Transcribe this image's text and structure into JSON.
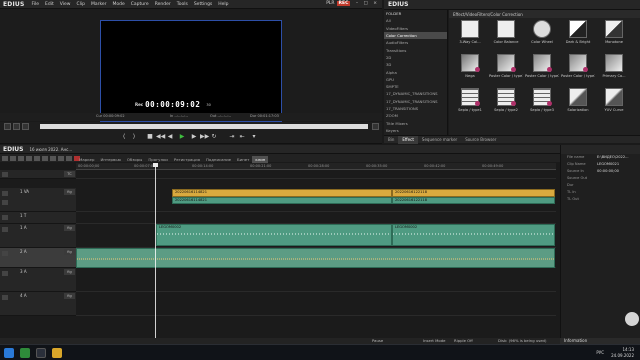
{
  "menubar": {
    "logo": "EDIUS",
    "items": [
      "File",
      "Edit",
      "View",
      "Clip",
      "Marker",
      "Mode",
      "Capture",
      "Render",
      "Tools",
      "Settings",
      "Help"
    ],
    "plr": "PLR",
    "rec": "REC"
  },
  "preview": {
    "tc_label": "Rec",
    "timecode": "00:00:09:02",
    "fs": "30",
    "bar": {
      "cur": "Cur 00:00:09:02",
      "in": "In --:--:--:--",
      "out": "Out --:--:--:--",
      "dur": "Dur 00:01:17:03"
    }
  },
  "bin": {
    "logo": "EDIUS",
    "folder_label": "FOLDER",
    "folders": [
      "All",
      "VideoFilters",
      "Color Correction",
      "AudioFilters",
      "Transitions",
      "2D",
      "3D",
      "Alpha",
      "GPU",
      "SMPTE",
      "17_DYNAMIC_TRANSITIONS",
      "17_DYNAMIC_TRANSITIONS",
      "17_TRANSITIONS",
      "ZOOM",
      "Title Mixers",
      "Keyers"
    ],
    "selected_folder": 2,
    "path": "Effect/VideoFilters/Color Correction",
    "effects": [
      {
        "name": "3-Way Col..."
      },
      {
        "name": "Color Balance"
      },
      {
        "name": "Color Wheel"
      },
      {
        "name": "Dark & Bright"
      },
      {
        "name": "Monotone"
      },
      {
        "name": "Nega"
      },
      {
        "name": "Poster Color / type1"
      },
      {
        "name": "Poster Color / type2"
      },
      {
        "name": "Poster Color / type3"
      },
      {
        "name": "Primary Co..."
      },
      {
        "name": "Sepia / type1"
      },
      {
        "name": "Sepia / type2"
      },
      {
        "name": "Sepia / type3"
      },
      {
        "name": "Solarization"
      },
      {
        "name": "YUV Curve"
      }
    ],
    "tabs": [
      "Bin",
      "Effect",
      "Sequence marker",
      "Source Browser"
    ],
    "active_tab": 1
  },
  "timeline": {
    "logo": "EDIUS",
    "project": "16 июля 2022. Анс...",
    "seq_tabs": [
      "Маркер",
      "Интервью",
      "Обзоры",
      "Прогулки",
      "Регистрация",
      "Подписание",
      "Бинет",
      "клип"
    ],
    "active_seq": 7,
    "ruler": [
      "00:00:00;00",
      "00:00:07:00",
      "00:00:14:00",
      "00:00:21:00",
      "00:00:28:00",
      "00:00:35:00",
      "00:00:42:00",
      "00:00:49:00"
    ],
    "tracks": [
      {
        "name": "",
        "sw": "TC"
      },
      {
        "name": "1 VA",
        "sw": ""
      },
      {
        "name": "1 T",
        "sw": ""
      },
      {
        "name": "1 A",
        "sw": ""
      },
      {
        "name": "2 A",
        "sw": ""
      },
      {
        "name": "3 A",
        "sw": ""
      },
      {
        "name": "4 A",
        "sw": ""
      }
    ],
    "clips": {
      "v1a": "20220616114821",
      "v1b": "20220616122118",
      "v2a": "20220616114821",
      "v2b": "20220616122118",
      "a1a": "LEGOM0002",
      "a1b": "LEGOM0002"
    }
  },
  "status": {
    "pause": "Pause",
    "insert": "Insert Mode",
    "ripple": "Ripple Off",
    "disk": "Disk: (96% is being used)"
  },
  "info": {
    "title": "",
    "rows": [
      {
        "k": "File name",
        "v": "E:\\ВИДЕО\\2022..."
      },
      {
        "k": "Clip Name",
        "v": "LEGOM0021"
      },
      {
        "k": "Source In",
        "v": "00:00:00;00"
      },
      {
        "k": "Source Out",
        "v": ""
      },
      {
        "k": "Dur",
        "v": ""
      },
      {
        "k": "TL In",
        "v": ""
      },
      {
        "k": "TL Out",
        "v": ""
      }
    ],
    "tab": "Information"
  },
  "taskbar": {
    "lang": "РУС",
    "time": "14:13",
    "date": "24.09.2022"
  }
}
